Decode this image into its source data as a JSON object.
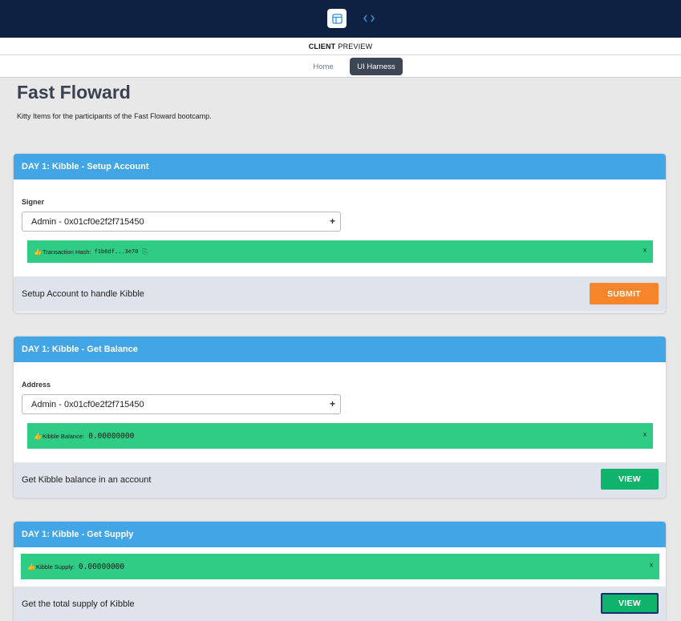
{
  "topbar": {
    "icons": [
      "layout-icon",
      "code-icon"
    ]
  },
  "preview": {
    "strong": "CLIENT",
    "rest": "PREVIEW"
  },
  "nav": {
    "home": "Home",
    "harness": "UI Harness"
  },
  "page": {
    "title": "Fast Floward",
    "description": "Kitty Items for the participants of the Fast Floward bootcamp."
  },
  "cards": {
    "setup": {
      "title": "DAY 1: Kibble - Setup Account",
      "field_label": "Signer",
      "select_value": "Admin - 0x01cf0e2f2f715450",
      "alert_label": "Transaction Hash:",
      "alert_value": "f1b6df...3e70",
      "alert_close": "x",
      "footer": "Setup Account to handle Kibble",
      "button": "SUBMIT"
    },
    "balance": {
      "title": "DAY 1: Kibble - Get Balance",
      "field_label": "Address",
      "select_value": "Admin - 0x01cf0e2f2f715450",
      "alert_label": "Kibble Balance:",
      "alert_value": "0.00000000",
      "alert_close": "x",
      "footer": "Get Kibble balance in an account",
      "button": "VIEW"
    },
    "supply": {
      "title": "DAY 1: Kibble - Get Supply",
      "alert_label": "Kibble Supply:",
      "alert_value": "0.00000000",
      "alert_close": "x",
      "footer": "Get the total supply of Kibble",
      "button": "VIEW"
    }
  },
  "colors": {
    "topbar": "#0f2143",
    "card_header": "#42a6e6",
    "alert": "#2ecc84",
    "submit": "#f7852b",
    "view": "#0fb36b"
  }
}
